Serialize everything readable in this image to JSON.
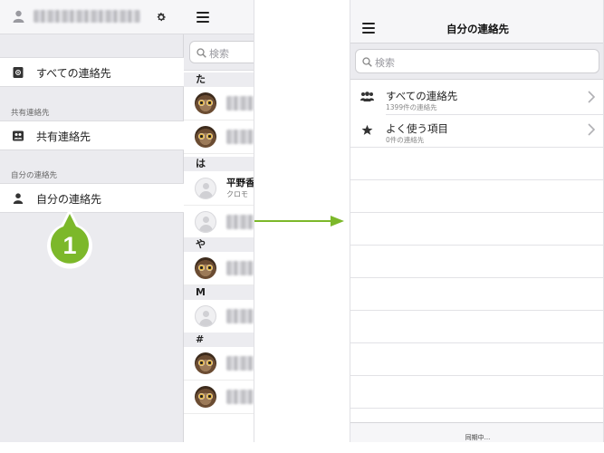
{
  "sidebar": {
    "items": [
      {
        "label": "すべての連絡先",
        "icon": "address-book-icon"
      },
      {
        "label": "共有連絡先",
        "icon": "shared-contacts-icon"
      },
      {
        "label": "自分の連絡先",
        "icon": "person-icon"
      }
    ],
    "sections": {
      "shared": "共有連絡先",
      "mine": "自分の連絡先"
    }
  },
  "callout": {
    "number": "1",
    "color": "#7cb82a"
  },
  "contact_list": {
    "search_placeholder": "検索",
    "index_headers": [
      "た",
      "は",
      "や",
      "M",
      "#"
    ],
    "visible_contact": {
      "name": "平野香",
      "sub": "クロモ"
    }
  },
  "right_panel": {
    "title": "自分の連絡先",
    "search_placeholder": "検索",
    "rows": [
      {
        "label": "すべての連絡先",
        "sub": "1399件の連絡先",
        "icon": "group-icon"
      },
      {
        "label": "よく使う項目",
        "sub": "0件の連絡先",
        "icon": "star-icon"
      }
    ],
    "footer": "同期中..."
  },
  "colors": {
    "accent_green": "#7cb82a",
    "arrow_green": "#7cb82a"
  }
}
